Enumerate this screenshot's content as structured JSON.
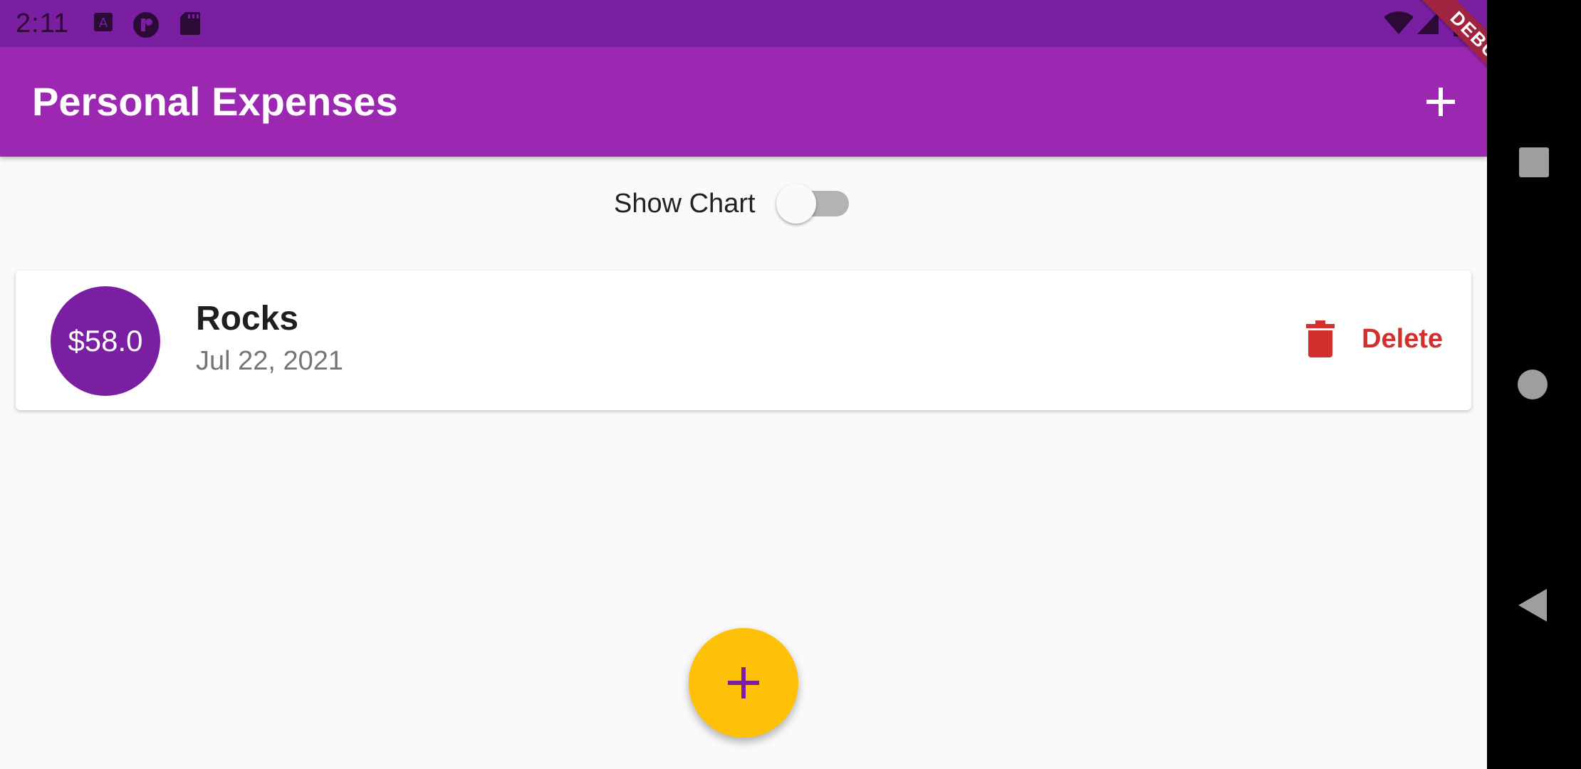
{
  "status_bar": {
    "time": "2:11",
    "icons": [
      "text-app-icon",
      "app-icon",
      "sd-card-icon",
      "wifi-icon",
      "signal-icon",
      "battery-icon"
    ]
  },
  "app_bar": {
    "title": "Personal Expenses",
    "add_icon": "plus-icon",
    "debug_banner": "DEBUG"
  },
  "chart_toggle": {
    "label": "Show Chart",
    "checked": false
  },
  "transactions": [
    {
      "amount": "$58.0",
      "title": "Rocks",
      "date": "Jul 22, 2021",
      "delete_label": "Delete",
      "delete_icon": "trash-icon"
    }
  ],
  "fab": {
    "icon": "plus-icon"
  },
  "nav_bar": {
    "buttons": [
      "recents-icon",
      "home-icon",
      "back-icon"
    ]
  },
  "colors": {
    "primary": "#9c27b0",
    "primary_dark": "#7b1fa2",
    "accent": "#ffc107",
    "delete": "#d32f2f"
  }
}
